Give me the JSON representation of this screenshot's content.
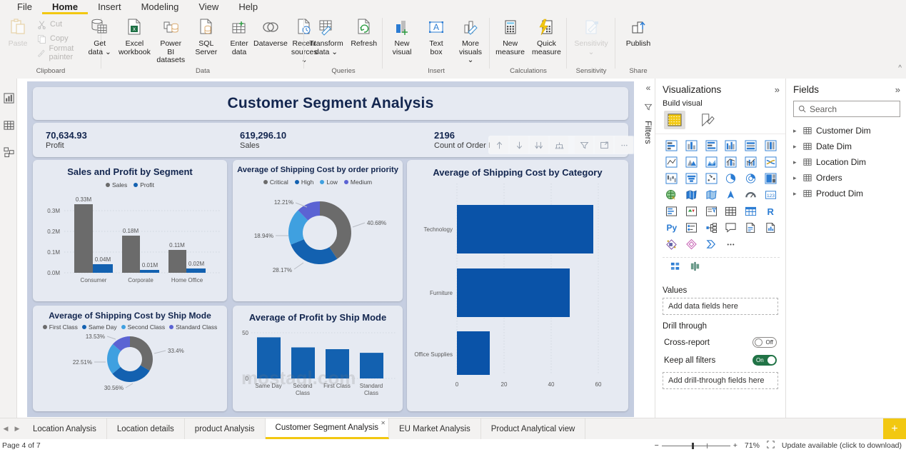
{
  "menu": {
    "items": [
      "File",
      "Home",
      "Insert",
      "Modeling",
      "View",
      "Help"
    ],
    "active": "Home"
  },
  "ribbon": {
    "groups": [
      {
        "label": "Clipboard",
        "buttons": [
          "Paste"
        ],
        "small": [
          "Cut",
          "Copy",
          "Format painter"
        ]
      },
      {
        "label": "Data",
        "buttons": [
          "Get data ⌄",
          "Excel workbook",
          "Power BI datasets",
          "SQL Server",
          "Enter data",
          "Dataverse",
          "Recent sources ⌄"
        ]
      },
      {
        "label": "Queries",
        "buttons": [
          "Transform data ⌄",
          "Refresh"
        ]
      },
      {
        "label": "Insert",
        "buttons": [
          "New visual",
          "Text box",
          "More visuals ⌄"
        ]
      },
      {
        "label": "Calculations",
        "buttons": [
          "New measure",
          "Quick measure"
        ]
      },
      {
        "label": "Sensitivity",
        "buttons": [
          "Sensitivity ⌄"
        ]
      },
      {
        "label": "Share",
        "buttons": [
          "Publish"
        ]
      }
    ]
  },
  "report": {
    "title": "Customer Segment Analysis",
    "kpis": [
      {
        "value": "70,634.93",
        "label": "Profit"
      },
      {
        "value": "619,296.10",
        "label": "Sales"
      },
      {
        "value": "2196",
        "label": "Count of Order ID"
      }
    ]
  },
  "chart_data": [
    {
      "id": "sales_profit_by_segment",
      "type": "bar",
      "title": "Sales and Profit by Segment",
      "categories": [
        "Consumer",
        "Corporate",
        "Home Office"
      ],
      "series": [
        {
          "name": "Sales",
          "values": [
            0.33,
            0.18,
            0.11
          ],
          "labels": [
            "0.33M",
            "0.18M",
            "0.11M"
          ],
          "color": "#6B6B6B"
        },
        {
          "name": "Profit",
          "values": [
            0.04,
            0.01,
            0.02
          ],
          "labels": [
            "0.04M",
            "0.01M",
            "0.02M"
          ],
          "color": "#1361B0"
        }
      ],
      "ylabel": "",
      "xlabel": "",
      "ylim": [
        0,
        0.35
      ],
      "yticks": [
        "0.0M",
        "0.1M",
        "0.2M",
        "0.3M"
      ],
      "grid": true,
      "legend_position": "top"
    },
    {
      "id": "shipping_cost_by_order_priority",
      "type": "pie",
      "title": "Average of Shipping Cost by order priority",
      "categories": [
        "Critical",
        "High",
        "Low",
        "Medium"
      ],
      "values": [
        40.68,
        28.17,
        18.94,
        12.21
      ],
      "labels": [
        "40.68%",
        "28.17%",
        "18.94%",
        "12.21%"
      ],
      "colors": [
        "#6B6B6B",
        "#1361B0",
        "#3FA0E0",
        "#5B63D3"
      ],
      "legend_position": "top"
    },
    {
      "id": "shipping_cost_by_category",
      "type": "bar",
      "title": "Average of Shipping Cost by Category",
      "orientation": "horizontal",
      "categories": [
        "Technology",
        "Furniture",
        "Office Supplies"
      ],
      "values": [
        58,
        48,
        14
      ],
      "color": "#0A53A8",
      "xlim": [
        0,
        60
      ],
      "xticks": [
        "0",
        "20",
        "40",
        "60"
      ],
      "grid": true
    },
    {
      "id": "shipping_cost_by_ship_mode",
      "type": "pie",
      "title": "Average of Shipping Cost by Ship Mode",
      "categories": [
        "First Class",
        "Same Day",
        "Second Class",
        "Standard Class"
      ],
      "values": [
        33.4,
        30.56,
        22.51,
        13.53
      ],
      "labels": [
        "33.4%",
        "30.56%",
        "22.51%",
        "13.53%"
      ],
      "colors": [
        "#6B6B6B",
        "#1361B0",
        "#3FA0E0",
        "#5B63D3"
      ],
      "legend_position": "top"
    },
    {
      "id": "profit_by_ship_mode",
      "type": "bar",
      "title": "Average of Profit by Ship Mode",
      "categories": [
        "Same Day",
        "Second Class",
        "First Class",
        "Standard Class"
      ],
      "values": [
        45,
        34,
        32,
        28
      ],
      "color": "#1361B0",
      "ylim": [
        0,
        50
      ],
      "yticks": [
        "0",
        "50"
      ],
      "grid": true
    }
  ],
  "visual_toolbar": {
    "buttons": [
      "drill-up",
      "drill-down",
      "expand-all",
      "drill-mode",
      "filter",
      "focus-mode",
      "more-options"
    ]
  },
  "filters_pane": {
    "label": "Filters"
  },
  "visualizations": {
    "title": "Visualizations",
    "build_label": "Build visual",
    "wells": {
      "values_label": "Values",
      "values_placeholder": "Add data fields here",
      "drill_label": "Drill through",
      "cross_report_label": "Cross-report",
      "cross_report_state": "Off",
      "keep_filters_label": "Keep all filters",
      "keep_filters_state": "On",
      "drill_placeholder": "Add drill-through fields here"
    },
    "icons": [
      "stacked-bar-chart-icon",
      "stacked-column-chart-icon",
      "clustered-bar-chart-icon",
      "clustered-column-chart-icon",
      "100-stacked-bar-chart-icon",
      "100-stacked-column-chart-icon",
      "line-chart-icon",
      "area-chart-icon",
      "stacked-area-chart-icon",
      "line-stacked-column-chart-icon",
      "line-clustered-column-chart-icon",
      "ribbon-chart-icon",
      "waterfall-chart-icon",
      "funnel-chart-icon",
      "scatter-chart-icon",
      "pie-chart-icon",
      "donut-chart-icon",
      "treemap-icon",
      "map-icon",
      "filled-map-icon",
      "shape-map-icon",
      "azure-map-icon",
      "gauge-icon",
      "card-icon",
      "multi-row-card-icon",
      "kpi-icon",
      "slicer-icon",
      "table-icon",
      "matrix-icon",
      "r-script-visual-icon",
      "python-visual-icon",
      "key-influencers-icon",
      "decomposition-tree-icon",
      "qna-icon",
      "smart-narrative-icon",
      "paginated-report-icon",
      "power-apps-icon",
      "power-automate-icon",
      "arcgis-maps-icon",
      "more-visuals-icon",
      "get-more-visuals-icon",
      "filter-visual-icon"
    ]
  },
  "fields": {
    "title": "Fields",
    "search_placeholder": "Search",
    "tables": [
      "Customer Dim",
      "Date Dim",
      "Location Dim",
      "Orders",
      "Product Dim"
    ]
  },
  "tabs": {
    "items": [
      "Location Analysis",
      "Location details",
      "product Analysis",
      "Customer Segment Analysis",
      "EU Market Analysis",
      "Product Analytical view"
    ],
    "active": "Customer Segment Analysis",
    "add_label": "+"
  },
  "status": {
    "page": "Page 4 of 7",
    "zoom": "71%",
    "update": "Update available (click to download)"
  },
  "colors": {
    "accent_yellow": "#F2C811",
    "title_navy": "#13264F",
    "bar_blue": "#1361B0",
    "bar_gray": "#6B6B6B",
    "category_blue": "#0A53A8"
  },
  "watermark": "mostaql.com"
}
